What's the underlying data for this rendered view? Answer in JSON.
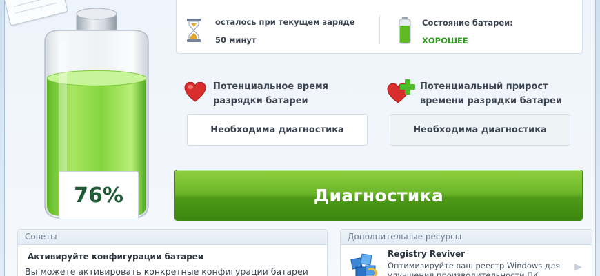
{
  "battery": {
    "charge_percent_label": "76%",
    "charge_fraction": 0.76,
    "colors": {
      "fill": "#66cc22",
      "frame": "#bfc9d3"
    }
  },
  "status": {
    "time_left_label": "осталось при текущем заряде",
    "time_left_value": "50 минут",
    "health_label": "Состояние батареи:",
    "health_value": "ХОРОШЕЕ",
    "health_color": "#2f9b1f"
  },
  "cards": {
    "potential_time_title": "Потенциальное время разрядки батареи",
    "potential_time_value": "Необходима диагностика",
    "potential_gain_title": "Потенциальный прирост времени разрядки батареи",
    "potential_gain_value": "Необходима диагностика"
  },
  "diagnose_button_label": "Диагностика",
  "tips": {
    "header": "Советы",
    "title": "Активируйте конфигурации батареи",
    "text": "Вы можете активировать конкретные конфигурации батареи"
  },
  "resources": {
    "header": "Дополнительные ресурсы",
    "name": "Registry Reviver",
    "description": "Оптимизируйте ваш реестр Windows для улучшения производительности ПК",
    "icon": "registry-reviver-icon"
  }
}
